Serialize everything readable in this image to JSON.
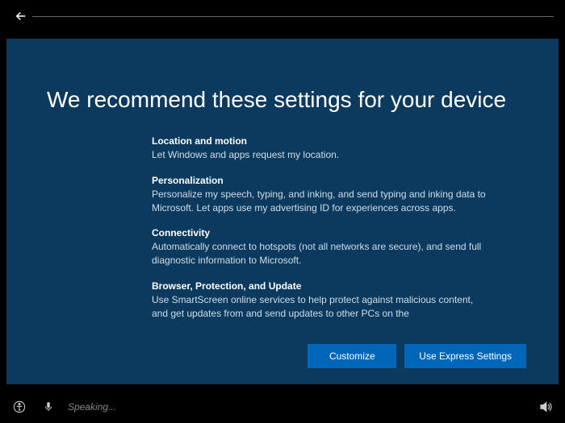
{
  "header": {
    "title": "We recommend these settings for your device"
  },
  "settings": [
    {
      "heading": "Location and motion",
      "description": "Let Windows and apps request my location."
    },
    {
      "heading": "Personalization",
      "description": "Personalize my speech, typing, and inking, and send typing and inking data to Microsoft. Let apps use my advertising ID for experiences across apps."
    },
    {
      "heading": "Connectivity",
      "description": "Automatically connect to hotspots (not all networks are secure), and send full diagnostic information to Microsoft."
    },
    {
      "heading": "Browser, Protection, and Update",
      "description": "Use SmartScreen online services to help protect against malicious content, and get updates from and send updates to other PCs on the"
    }
  ],
  "buttons": {
    "customize": "Customize",
    "express": "Use Express Settings"
  },
  "footer": {
    "speaking": "Speaking..."
  }
}
